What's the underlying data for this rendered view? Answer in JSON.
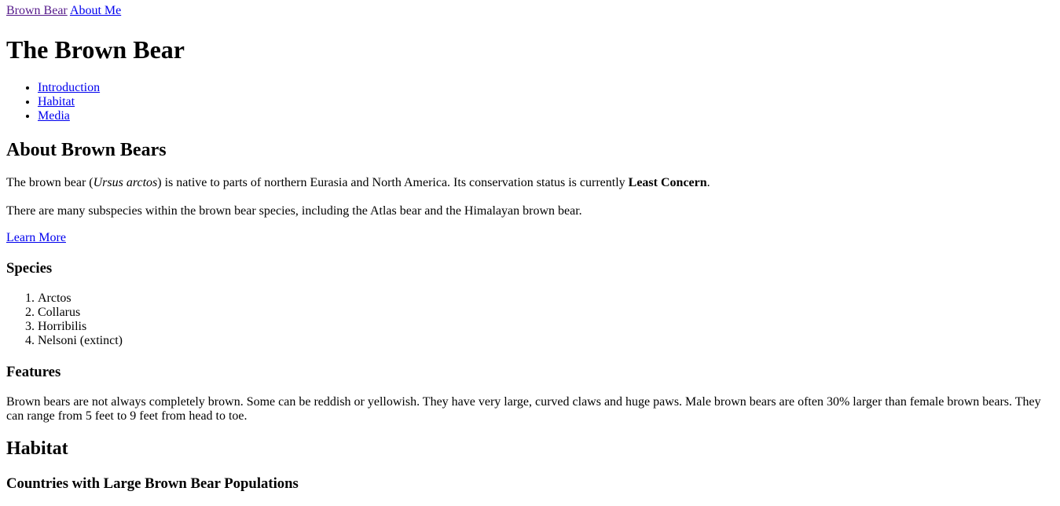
{
  "nav": {
    "brown_bear": "Brown Bear",
    "about_me": "About Me"
  },
  "title": "The Brown Bear",
  "toc": [
    "Introduction",
    "Habitat",
    "Media"
  ],
  "about": {
    "heading": "About Brown Bears",
    "p1_before": "The brown bear (",
    "p1_italic": "Ursus arctos",
    "p1_middle": ") is native to parts of northern Eurasia and North America. Its conservation status is currently ",
    "p1_bold": "Least Concern",
    "p1_end": ".",
    "p2": "There are many subspecies within the brown bear species, including the Atlas bear and the Himalayan brown bear.",
    "learn_more": "Learn More"
  },
  "species": {
    "heading": "Species",
    "items": [
      "Arctos",
      "Collarus",
      "Horribilis",
      "Nelsoni (extinct)"
    ]
  },
  "features": {
    "heading": "Features",
    "text": "Brown bears are not always completely brown. Some can be reddish or yellowish. They have very large, curved claws and huge paws. Male brown bears are often 30% larger than female brown bears. They can range from 5 feet to 9 feet from head to toe."
  },
  "habitat": {
    "heading": "Habitat",
    "subheading": "Countries with Large Brown Bear Populations"
  },
  "colors": {
    "link": "#0000ee",
    "visited_link": "#551a8b",
    "text": "#000000",
    "background": "#ffffff"
  }
}
